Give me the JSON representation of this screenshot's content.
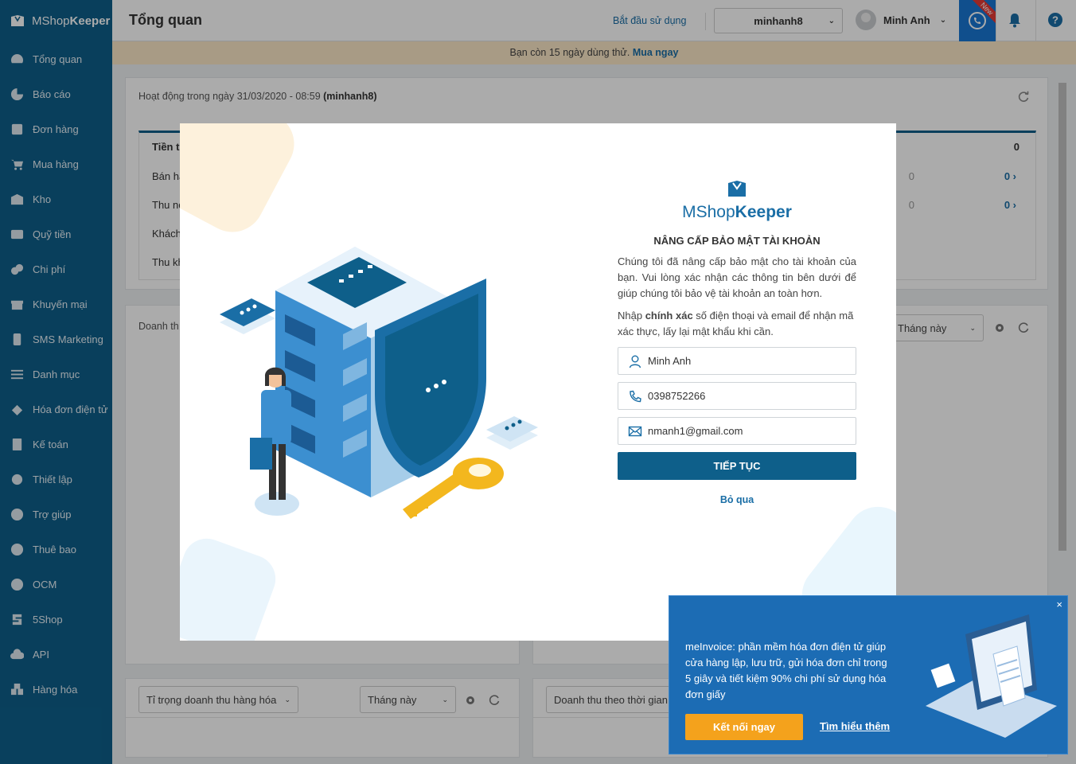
{
  "brand": {
    "name_light": "MShop",
    "name_bold": "Keeper"
  },
  "sidebar": {
    "items": [
      {
        "label": "Tổng quan",
        "icon": "dashboard-icon"
      },
      {
        "label": "Báo cáo",
        "icon": "pie-chart-icon"
      },
      {
        "label": "Đơn hàng",
        "icon": "order-icon"
      },
      {
        "label": "Mua hàng",
        "icon": "cart-icon"
      },
      {
        "label": "Kho",
        "icon": "warehouse-icon"
      },
      {
        "label": "Quỹ tiền",
        "icon": "cash-icon"
      },
      {
        "label": "Chi phí",
        "icon": "coins-icon"
      },
      {
        "label": "Khuyến mại",
        "icon": "gift-icon"
      },
      {
        "label": "SMS Marketing",
        "icon": "phone-icon"
      },
      {
        "label": "Danh mục",
        "icon": "list-icon"
      },
      {
        "label": "Hóa đơn điện tử",
        "icon": "invoice-icon"
      },
      {
        "label": "Kế toán",
        "icon": "calculator-icon"
      },
      {
        "label": "Thiết lập",
        "icon": "gear-icon"
      },
      {
        "label": "Trợ giúp",
        "icon": "question-icon"
      },
      {
        "label": "Thuê bao",
        "icon": "user-circle-icon"
      },
      {
        "label": "OCM",
        "icon": "ocm-icon"
      },
      {
        "label": "5Shop",
        "icon": "fiveshop-icon"
      },
      {
        "label": "API",
        "icon": "cloud-upload-icon"
      },
      {
        "label": "Hàng hóa",
        "icon": "goods-icon"
      }
    ]
  },
  "header": {
    "title": "Tổng quan",
    "start_link": "Bắt đầu sử dụng",
    "store": "minhanh8",
    "user": "Minh Anh",
    "new_badge": "New"
  },
  "trial": {
    "text": "Bạn còn 15 ngày dùng thử.",
    "link": "Mua ngay"
  },
  "background": {
    "activity_title_prefix": "Hoạt động trong ngày 31/03/2020 - 08:59",
    "activity_user": "(minhanh8)",
    "rows": [
      {
        "label": "Tiền t",
        "value": "0"
      },
      {
        "label": "Bán hà",
        "value": "0",
        "count": "0"
      },
      {
        "label": "Thu nợ",
        "value": "0",
        "count": "0"
      },
      {
        "label": "Khách",
        "value": ""
      },
      {
        "label": "Thu kh",
        "value": ""
      }
    ],
    "revenue_title": "Doanh th",
    "period_select": "Tháng này",
    "product_share_select": "Tỉ trọng doanh thu hàng hóa",
    "period_select_2": "Tháng này",
    "revenue_time_select": "Doanh thu theo thời gian"
  },
  "modal": {
    "logo_light": "MShop",
    "logo_bold": "Keeper",
    "title": "NÂNG CẤP BẢO MẬT TÀI KHOẢN",
    "description": "Chúng tôi đã nâng cấp bảo mật cho tài khoản của bạn. Vui lòng xác nhận các thông tin bên dưới để giúp chúng tôi bảo vệ tài khoản an toàn hơn.",
    "instr_prefix": "Nhập",
    "instr_bold": "chính xác",
    "instr_suffix": "số điện thoại và email để nhận mã xác thực, lấy lại mật khẩu khi cần.",
    "name_value": "Minh Anh",
    "phone_value": "0398752266",
    "email_value": "nmanh1@gmail.com",
    "continue_label": "TIẾP TỤC",
    "skip_label": "Bỏ qua"
  },
  "promo": {
    "text": "meInvoice: phần mềm hóa đơn điện tử giúp cửa hàng lập, lưu trữ, gửi hóa đơn chỉ trong 5 giây và tiết kiệm 90% chi phí sử dụng hóa đơn giấy",
    "button": "Kết nối ngay",
    "link": "Tìm hiểu thêm",
    "close": "×"
  },
  "colors": {
    "sidebar": "#0e5f8a",
    "accent": "#1a6ea6",
    "promo": "#1c6cb4",
    "orange": "#f4a21c"
  }
}
